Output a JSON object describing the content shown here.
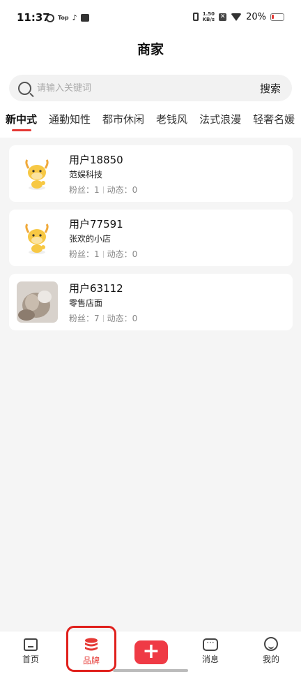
{
  "status_bar": {
    "time": "11:37",
    "top_badge": "Top",
    "speed_value": "1.50",
    "speed_unit": "KB/s",
    "battery_percent": "20%",
    "battery_level": 0.2,
    "battery_color": "#e53935"
  },
  "header": {
    "title": "商家"
  },
  "search": {
    "placeholder": "请输入关键词",
    "button_label": "搜索"
  },
  "tabs": [
    {
      "label": "新中式",
      "active": true
    },
    {
      "label": "通勤知性"
    },
    {
      "label": "都市休闲"
    },
    {
      "label": "老钱风"
    },
    {
      "label": "法式浪漫"
    },
    {
      "label": "轻奢名媛"
    }
  ],
  "merchants": [
    {
      "name": "用户18850",
      "shop": "范娱科技",
      "fans_label": "粉丝：",
      "fans": "1",
      "dynamic_label": "动态：",
      "dynamic": "0",
      "avatar": "ox-mascot-icon"
    },
    {
      "name": "用户77591",
      "shop": "张欢的小店",
      "fans_label": "粉丝：",
      "fans": "1",
      "dynamic_label": "动态：",
      "dynamic": "0",
      "avatar": "ox-mascot-icon"
    },
    {
      "name": "用户63112",
      "shop": "零售店面",
      "fans_label": "粉丝：",
      "fans": "7",
      "dynamic_label": "动态：",
      "dynamic": "0",
      "avatar": "photo-avatar"
    }
  ],
  "bottom_nav": {
    "home": "首页",
    "brand": "品牌",
    "publish_symbol": "+",
    "messages": "消息",
    "me": "我的",
    "active_color": "#e53935"
  }
}
